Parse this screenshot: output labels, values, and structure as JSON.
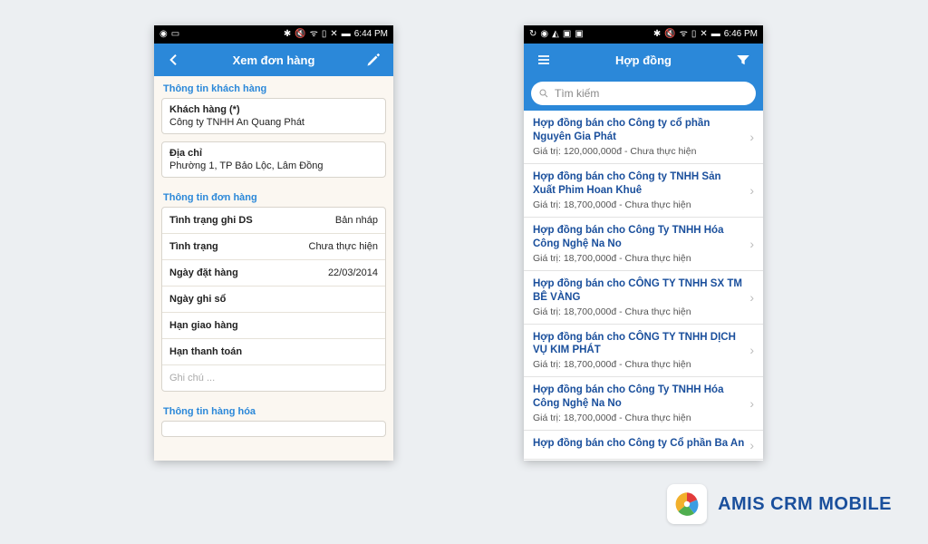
{
  "brand": {
    "name": "AMIS CRM MOBILE"
  },
  "phoneLeft": {
    "status": {
      "time": "6:44 PM"
    },
    "header": {
      "title": "Xem đơn hàng"
    },
    "sections": {
      "customer_label": "Thông tin khách hàng",
      "customer": {
        "name_label": "Khách hàng  (*)",
        "name_value": "Công ty TNHH An Quang Phát",
        "addr_label": "Địa chỉ",
        "addr_value": "Phường 1, TP Bảo Lộc, Lâm Đồng"
      },
      "order_label": "Thông tin đơn hàng",
      "order_rows": [
        {
          "k": "Tình trạng ghi DS",
          "v": "Bản nháp"
        },
        {
          "k": "Tình trạng",
          "v": "Chưa thực hiện"
        },
        {
          "k": "Ngày đặt hàng",
          "v": "22/03/2014"
        },
        {
          "k": "Ngày ghi sổ",
          "v": ""
        },
        {
          "k": "Hạn giao hàng",
          "v": ""
        },
        {
          "k": "Hạn thanh toán",
          "v": ""
        }
      ],
      "note_placeholder": "Ghi chú ...",
      "goods_label": "Thông tin hàng hóa"
    }
  },
  "phoneRight": {
    "status": {
      "time": "6:46 PM"
    },
    "header": {
      "title": "Hợp đồng"
    },
    "search": {
      "placeholder": "Tìm kiếm"
    },
    "items": [
      {
        "title": "Hợp đồng bán cho Công ty cổ phần Nguyên Gia Phát",
        "sub": "Giá trị: 120,000,000đ - Chưa thực hiện"
      },
      {
        "title": "Hợp đồng bán cho  Công ty TNHH Sản Xuất Phim Hoan Khuê",
        "sub": "Giá trị: 18,700,000đ - Chưa thực hiện"
      },
      {
        "title": "Hợp đồng bán cho  Công Ty TNHH Hóa Công Nghệ Na No",
        "sub": "Giá trị: 18,700,000đ - Chưa thực hiện"
      },
      {
        "title": "Hợp đồng bán cho  CÔNG TY TNHH SX TM BÊ VÀNG",
        "sub": "Giá trị: 18,700,000đ - Chưa thực hiện"
      },
      {
        "title": "Hợp đồng bán cho  CÔNG TY TNHH DỊCH VỤ KIM PHÁT",
        "sub": "Giá trị: 18,700,000đ - Chưa thực hiện"
      },
      {
        "title": "Hợp đồng bán cho  Công Ty TNHH Hóa Công Nghệ Na No",
        "sub": "Giá trị: 18,700,000đ - Chưa thực hiện"
      },
      {
        "title": "Hợp đồng bán cho  Công ty Cổ phần Ba An",
        "sub": ""
      }
    ]
  }
}
